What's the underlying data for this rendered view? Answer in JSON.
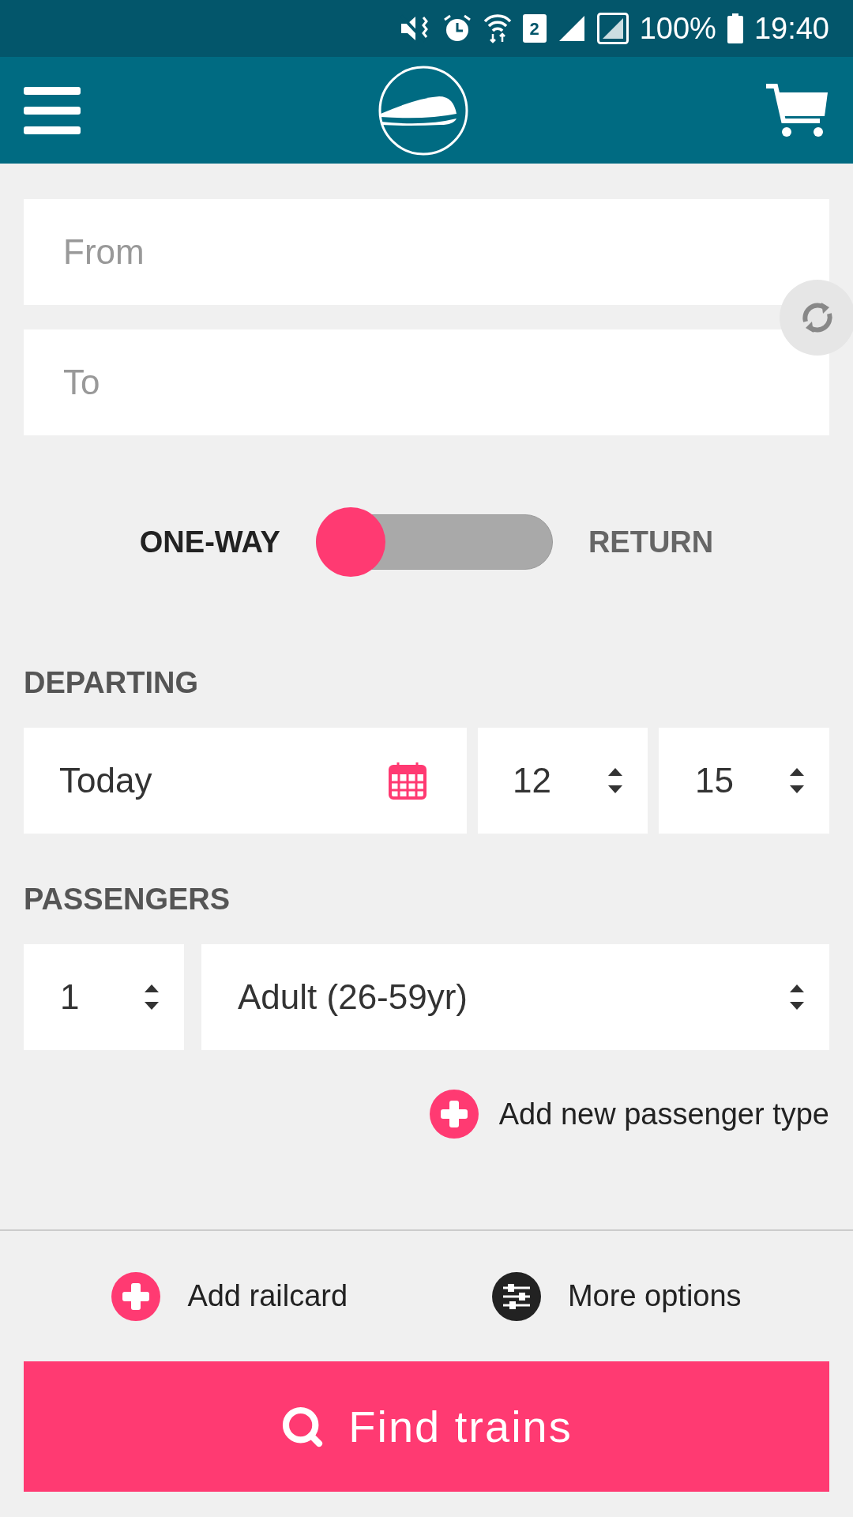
{
  "status_bar": {
    "sim_slot": "2",
    "battery": "100%",
    "time": "19:40"
  },
  "from": {
    "placeholder": "From"
  },
  "to": {
    "placeholder": "To"
  },
  "trip_type": [
    {
      "label": "ONE-WAY",
      "selected": true
    },
    {
      "label": "RETURN",
      "selected": false
    }
  ],
  "departing": {
    "label": "DEPARTING",
    "date": "Today",
    "hour": "12",
    "minute": "15"
  },
  "passengers": {
    "label": "PASSENGERS",
    "count": "1",
    "type": "Adult (26-59yr)",
    "add_type": "Add new passenger type"
  },
  "options": {
    "railcard": "Add railcard",
    "more": "More options"
  },
  "find_button": "Find trains"
}
